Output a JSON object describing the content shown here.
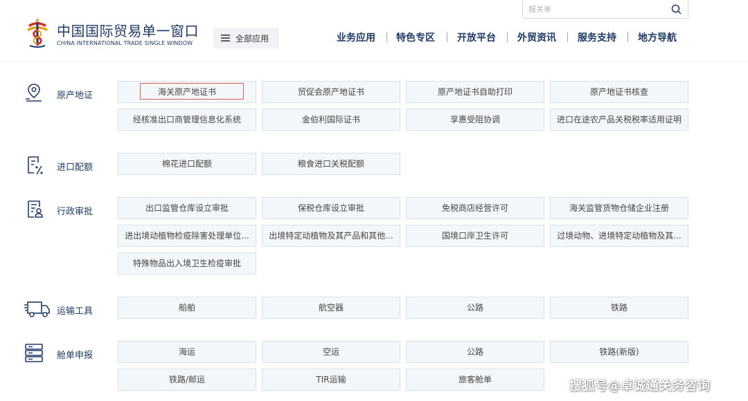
{
  "colors": {
    "brand": "#1e3a68",
    "button_bg": "#f3f7fa",
    "button_border": "#d7e2ea",
    "highlight": "#e05a5a"
  },
  "logo": {
    "name_cn": "中国国际贸易单一窗口",
    "name_en": "CHINA INTERNATIONAL TRADE SINGLE WINDOW"
  },
  "all_apps": {
    "label": "全部应用",
    "icon": "menu-icon"
  },
  "search": {
    "placeholder": "报关单",
    "icon": "search-icon"
  },
  "nav": [
    "业务应用",
    "特色专区",
    "开放平台",
    "外贸资讯",
    "服务支持",
    "地方导航"
  ],
  "categories": [
    {
      "label": "原产地证",
      "icon": "map-pin-icon",
      "items": [
        "海关原产地证书",
        "贸促会原产地证书",
        "原产地证书自助打印",
        "原产地证书核查",
        "经核准出口商管理信息化系统",
        "金伯利国际证书",
        "享惠受阻协调",
        "进口在途农产品关税税率适用证明"
      ]
    },
    {
      "label": "进口配额",
      "icon": "quota-document-icon",
      "items": [
        "棉花进口配额",
        "粮食进口关税配额"
      ]
    },
    {
      "label": "行政审批",
      "icon": "approval-document-icon",
      "items": [
        "出口监管仓库设立审批",
        "保税仓库设立审批",
        "免税商店经营许可",
        "海关监管货物仓储企业注册",
        "进出境动植物检疫除害处理单位...",
        "出境特定动植物及其产品和其他...",
        "国境口岸卫生许可",
        "过境动物、进境特定动植物及其...",
        "特殊物品出入境卫生检疫审批"
      ]
    },
    {
      "label": "运输工具",
      "icon": "truck-icon",
      "items": [
        "船舶",
        "航空器",
        "公路",
        "铁路"
      ]
    },
    {
      "label": "舱单申报",
      "icon": "manifest-server-icon",
      "items": [
        "海运",
        "空运",
        "公路",
        "铁路(新版)",
        "铁路/邮运",
        "TIR运输",
        "旅客舱单"
      ]
    }
  ],
  "watermark": "搜狐号@卓诚通关务咨询"
}
